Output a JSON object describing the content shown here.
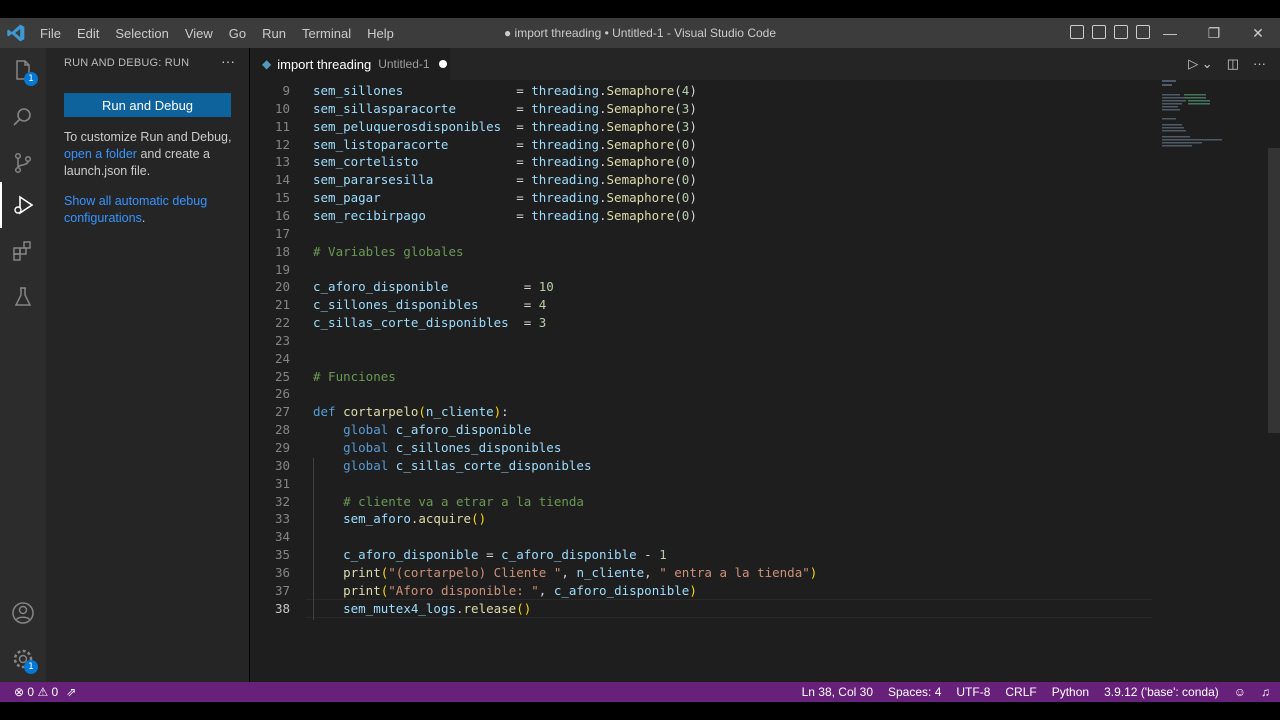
{
  "window": {
    "title": "● import threading • Untitled-1 - Visual Studio Code",
    "menu": [
      "File",
      "Edit",
      "Selection",
      "View",
      "Go",
      "Run",
      "Terminal",
      "Help"
    ],
    "controls": {
      "minimize": "—",
      "restore": "❐",
      "close": "✕"
    }
  },
  "activity_bar": {
    "explorer_badge": "1",
    "settings_badge": "1",
    "icons": [
      "files-icon",
      "search-icon",
      "source-control-icon",
      "run-debug-icon",
      "extensions-icon",
      "testing-icon",
      "account-icon",
      "settings-gear-icon"
    ],
    "active": "run-debug-icon"
  },
  "sidebar": {
    "header": "RUN AND DEBUG: RUN",
    "more": "···",
    "run_button": "Run and Debug",
    "text1_pre": "To customize Run and Debug, ",
    "text1_link": "open a folder",
    "text1_post": " and create a launch.json file.",
    "text2_link": "Show all automatic debug configurations",
    "text2_post": "."
  },
  "tab": {
    "label": "import threading",
    "sublabel": "Untitled-1",
    "icon": "python-icon",
    "dirty": true
  },
  "code_lines": [
    {
      "n": "9",
      "parts": [
        [
          "v",
          "sem_sillones"
        ],
        [
          "p",
          "               = "
        ],
        [
          "v",
          "threading"
        ],
        [
          "p",
          "."
        ],
        [
          "f",
          "Semaphore"
        ],
        [
          "p",
          "("
        ],
        [
          "n",
          "4"
        ],
        [
          "p",
          ")"
        ]
      ]
    },
    {
      "n": "10",
      "parts": [
        [
          "v",
          "sem_sillasparacorte"
        ],
        [
          "p",
          "        = "
        ],
        [
          "v",
          "threading"
        ],
        [
          "p",
          "."
        ],
        [
          "f",
          "Semaphore"
        ],
        [
          "p",
          "("
        ],
        [
          "n",
          "3"
        ],
        [
          "p",
          ")"
        ]
      ]
    },
    {
      "n": "11",
      "parts": [
        [
          "v",
          "sem_peluquerosdisponibles"
        ],
        [
          "p",
          "  = "
        ],
        [
          "v",
          "threading"
        ],
        [
          "p",
          "."
        ],
        [
          "f",
          "Semaphore"
        ],
        [
          "p",
          "("
        ],
        [
          "n",
          "3"
        ],
        [
          "p",
          ")"
        ]
      ]
    },
    {
      "n": "12",
      "parts": [
        [
          "v",
          "sem_listoparacorte"
        ],
        [
          "p",
          "         = "
        ],
        [
          "v",
          "threading"
        ],
        [
          "p",
          "."
        ],
        [
          "f",
          "Semaphore"
        ],
        [
          "p",
          "("
        ],
        [
          "n",
          "0"
        ],
        [
          "p",
          ")"
        ]
      ]
    },
    {
      "n": "13",
      "parts": [
        [
          "v",
          "sem_cortelisto"
        ],
        [
          "p",
          "             = "
        ],
        [
          "v",
          "threading"
        ],
        [
          "p",
          "."
        ],
        [
          "f",
          "Semaphore"
        ],
        [
          "p",
          "("
        ],
        [
          "n",
          "0"
        ],
        [
          "p",
          ")"
        ]
      ]
    },
    {
      "n": "14",
      "parts": [
        [
          "v",
          "sem_pararsesilla"
        ],
        [
          "p",
          "           = "
        ],
        [
          "v",
          "threading"
        ],
        [
          "p",
          "."
        ],
        [
          "f",
          "Semaphore"
        ],
        [
          "p",
          "("
        ],
        [
          "n",
          "0"
        ],
        [
          "p",
          ")"
        ]
      ]
    },
    {
      "n": "15",
      "parts": [
        [
          "v",
          "sem_pagar"
        ],
        [
          "p",
          "                  = "
        ],
        [
          "v",
          "threading"
        ],
        [
          "p",
          "."
        ],
        [
          "f",
          "Semaphore"
        ],
        [
          "p",
          "("
        ],
        [
          "n",
          "0"
        ],
        [
          "p",
          ")"
        ]
      ]
    },
    {
      "n": "16",
      "parts": [
        [
          "v",
          "sem_recibirpago"
        ],
        [
          "p",
          "            = "
        ],
        [
          "v",
          "threading"
        ],
        [
          "p",
          "."
        ],
        [
          "f",
          "Semaphore"
        ],
        [
          "p",
          "("
        ],
        [
          "n",
          "0"
        ],
        [
          "p",
          ")"
        ]
      ]
    },
    {
      "n": "17",
      "parts": []
    },
    {
      "n": "18",
      "parts": [
        [
          "c",
          "# Variables globales"
        ]
      ]
    },
    {
      "n": "19",
      "parts": []
    },
    {
      "n": "20",
      "parts": [
        [
          "v",
          "c_aforo_disponible"
        ],
        [
          "p",
          "          = "
        ],
        [
          "n",
          "10"
        ]
      ]
    },
    {
      "n": "21",
      "parts": [
        [
          "v",
          "c_sillones_disponibles"
        ],
        [
          "p",
          "      = "
        ],
        [
          "n",
          "4"
        ]
      ]
    },
    {
      "n": "22",
      "parts": [
        [
          "v",
          "c_sillas_corte_disponibles"
        ],
        [
          "p",
          "  = "
        ],
        [
          "n",
          "3"
        ]
      ]
    },
    {
      "n": "23",
      "parts": []
    },
    {
      "n": "24",
      "parts": []
    },
    {
      "n": "25",
      "parts": [
        [
          "c",
          "# Funciones"
        ]
      ]
    },
    {
      "n": "26",
      "parts": []
    },
    {
      "n": "27",
      "parts": [
        [
          "k",
          "def"
        ],
        [
          "p",
          " "
        ],
        [
          "f",
          "cortarpelo"
        ],
        [
          "br",
          "("
        ],
        [
          "v",
          "n_cliente"
        ],
        [
          "br",
          ")"
        ],
        [
          "p",
          ":"
        ]
      ]
    },
    {
      "n": "28",
      "parts": [
        [
          "p",
          "    "
        ],
        [
          "k",
          "global"
        ],
        [
          "p",
          " "
        ],
        [
          "v",
          "c_aforo_disponible"
        ]
      ]
    },
    {
      "n": "29",
      "parts": [
        [
          "p",
          "    "
        ],
        [
          "k",
          "global"
        ],
        [
          "p",
          " "
        ],
        [
          "v",
          "c_sillones_disponibles"
        ]
      ]
    },
    {
      "n": "30",
      "parts": [
        [
          "p",
          "    "
        ],
        [
          "k",
          "global"
        ],
        [
          "p",
          " "
        ],
        [
          "v",
          "c_sillas_corte_disponibles"
        ]
      ]
    },
    {
      "n": "31",
      "parts": []
    },
    {
      "n": "32",
      "parts": [
        [
          "p",
          "    "
        ],
        [
          "c",
          "# cliente va a etrar a la tienda"
        ]
      ]
    },
    {
      "n": "33",
      "parts": [
        [
          "p",
          "    "
        ],
        [
          "v",
          "sem_aforo"
        ],
        [
          "p",
          "."
        ],
        [
          "f",
          "acquire"
        ],
        [
          "br",
          "()"
        ]
      ]
    },
    {
      "n": "34",
      "parts": []
    },
    {
      "n": "35",
      "parts": [
        [
          "p",
          "    "
        ],
        [
          "v",
          "c_aforo_disponible"
        ],
        [
          "p",
          " = "
        ],
        [
          "v",
          "c_aforo_disponible"
        ],
        [
          "p",
          " - "
        ],
        [
          "n",
          "1"
        ]
      ]
    },
    {
      "n": "36",
      "parts": [
        [
          "p",
          "    "
        ],
        [
          "f",
          "print"
        ],
        [
          "br",
          "("
        ],
        [
          "s",
          "\"(cortarpelo) Cliente \""
        ],
        [
          "p",
          ", "
        ],
        [
          "v",
          "n_cliente"
        ],
        [
          "p",
          ", "
        ],
        [
          "s",
          "\" entra a la tienda\""
        ],
        [
          "br",
          ")"
        ]
      ]
    },
    {
      "n": "37",
      "parts": [
        [
          "p",
          "    "
        ],
        [
          "f",
          "print"
        ],
        [
          "br",
          "("
        ],
        [
          "s",
          "\"Aforo disponible: \""
        ],
        [
          "p",
          ", "
        ],
        [
          "v",
          "c_aforo_disponible"
        ],
        [
          "br",
          ")"
        ]
      ]
    },
    {
      "n": "38",
      "parts": [
        [
          "p",
          "    "
        ],
        [
          "v",
          "sem_mutex4_logs"
        ],
        [
          "p",
          "."
        ],
        [
          "f",
          "release"
        ],
        [
          "br",
          "()"
        ]
      ]
    }
  ],
  "current_line": "38",
  "status_bar": {
    "errors": "0",
    "warnings": "0",
    "position": "Ln 38, Col 30",
    "spaces": "Spaces: 4",
    "encoding": "UTF-8",
    "eol": "CRLF",
    "language": "Python",
    "interpreter": "3.9.12 ('base': conda)"
  },
  "colors": {
    "status_bar": "#68217a",
    "accent": "#0e639c",
    "link": "#3794ff"
  }
}
